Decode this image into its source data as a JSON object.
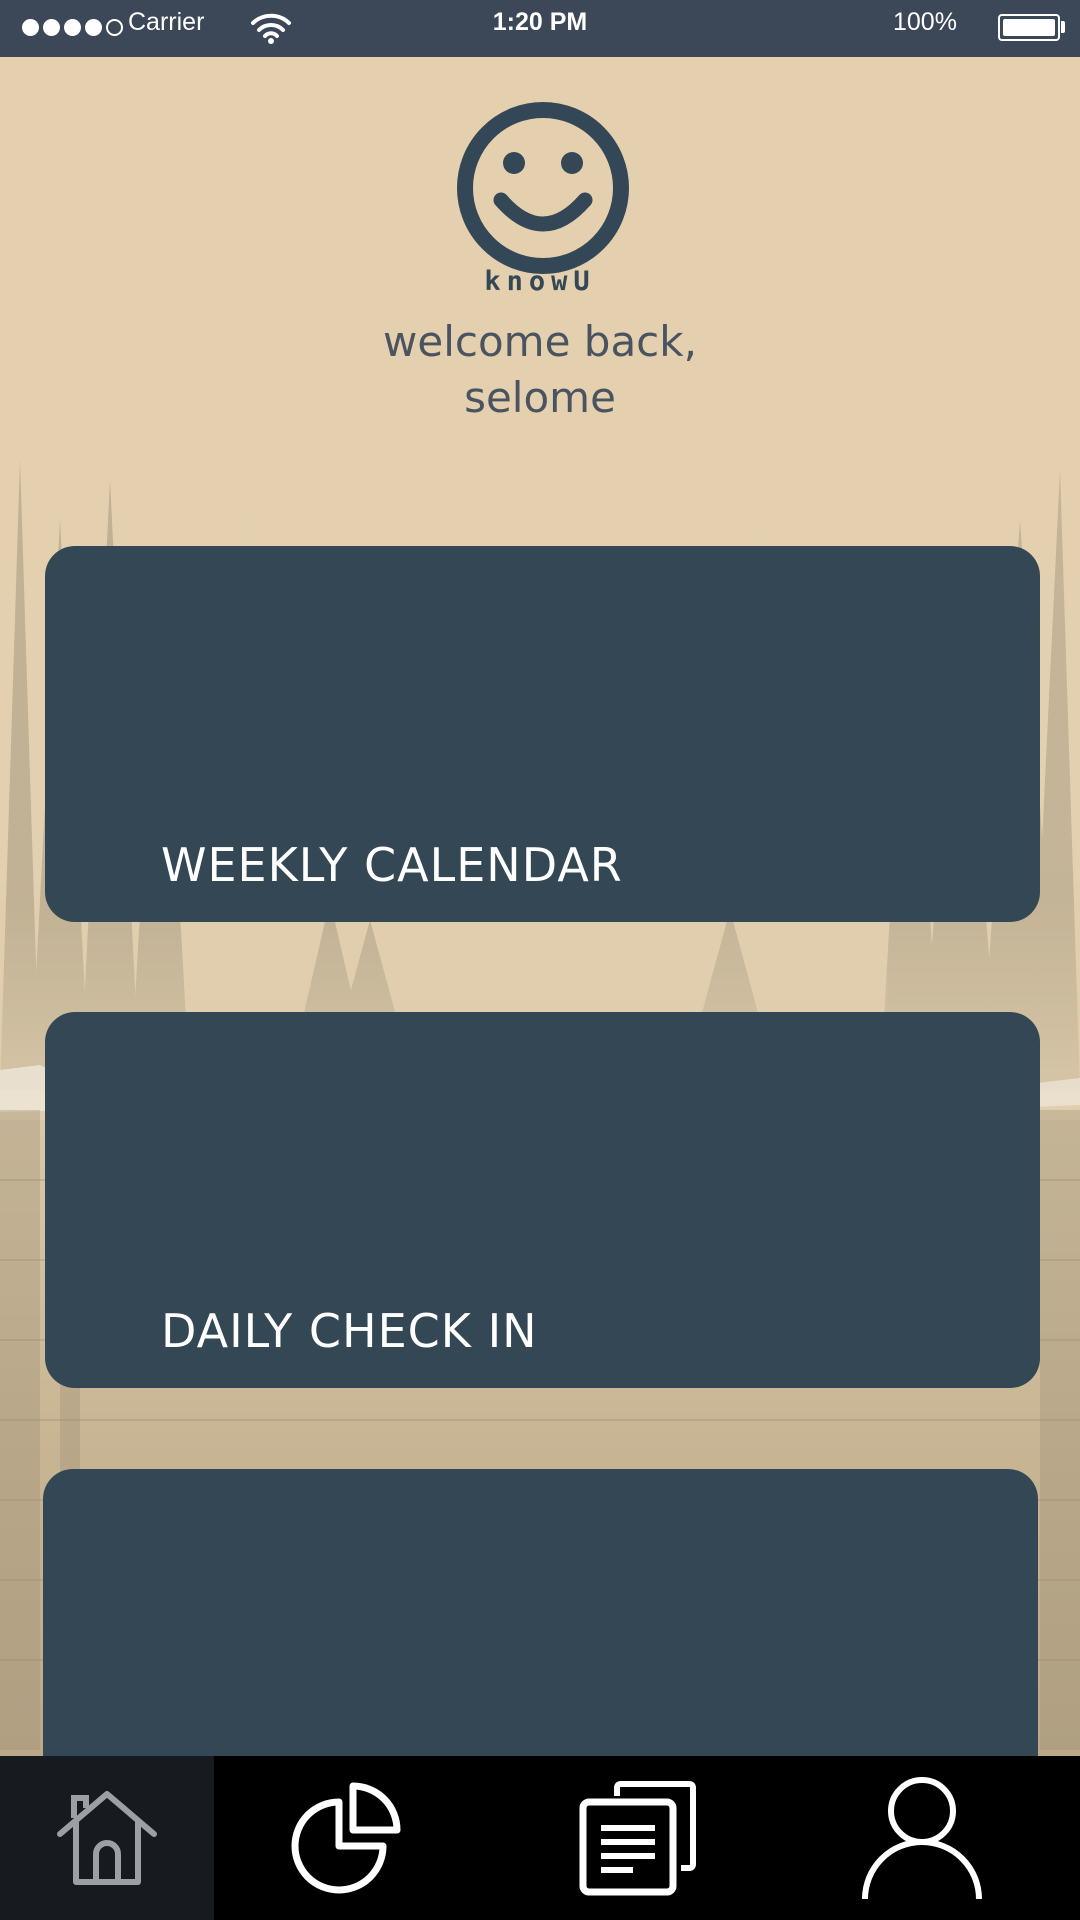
{
  "status_bar": {
    "carrier": "Carrier",
    "time": "1:20 PM",
    "battery": "100%",
    "signal_bars_filled": 4,
    "signal_bars_total": 5
  },
  "header": {
    "brand": "knowU",
    "welcome_line1": "welcome back,",
    "welcome_line2": "selome"
  },
  "cards": [
    {
      "label": "WEEKLY CALENDAR"
    },
    {
      "label": "DAILY CHECK IN"
    },
    {
      "label": ""
    }
  ],
  "tab_bar": {
    "items": [
      {
        "icon": "home-icon",
        "active": true
      },
      {
        "icon": "pie-chart-icon",
        "active": false
      },
      {
        "icon": "documents-icon",
        "active": false
      },
      {
        "icon": "user-icon",
        "active": false
      }
    ]
  },
  "colors": {
    "status_bar": "#3c4757",
    "card": "#334755",
    "background": "#e6d2b0",
    "tab_bar": "#000000",
    "tab_active": "#171b1f"
  }
}
